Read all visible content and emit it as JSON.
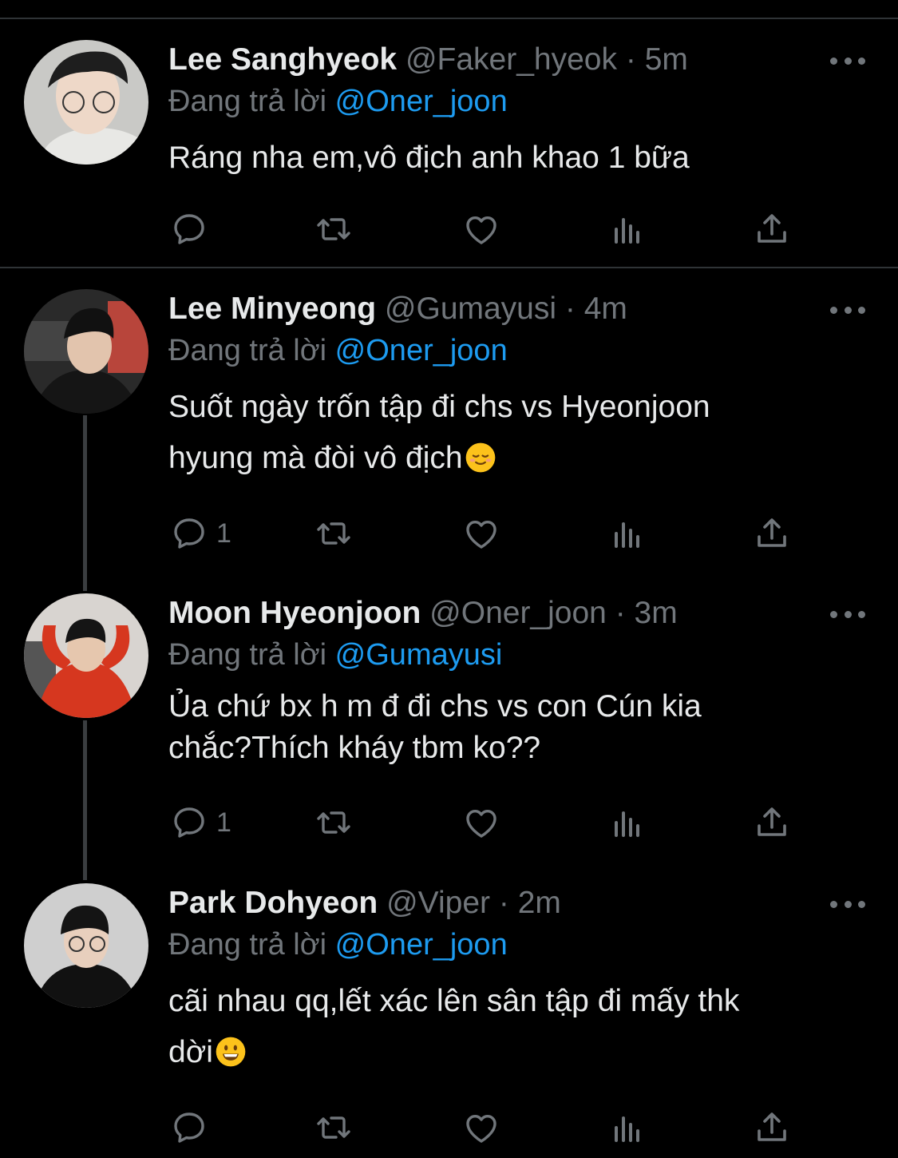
{
  "colors": {
    "background": "#000000",
    "text": "#e7e9ea",
    "muted": "#71767b",
    "accent": "#1d9bf0",
    "divider": "#2f3336"
  },
  "tweets": [
    {
      "name": "Lee Sanghyeok",
      "handle": "@Faker_hyeok",
      "separator": "·",
      "time": "5m",
      "reply_prefix": "Đang trả lời",
      "reply_to": "@Oner_joon",
      "text_lines": [
        "Ráng nha em,vô địch anh khao 1 bữa"
      ],
      "reply_count": "",
      "avatar_icon": "avatar-photo"
    },
    {
      "name": "Lee Minyeong",
      "handle": "@Gumayusi",
      "separator": "·",
      "time": "4m",
      "reply_prefix": "Đang trả lời",
      "reply_to": "@Oner_joon",
      "text_lines": [
        "Suốt ngày trốn tập đi chs vs Hyeonjoon",
        "hyung mà đòi vô địch"
      ],
      "text_emoji": "relieved-face-emoji",
      "reply_count": "1",
      "avatar_icon": "avatar-photo"
    },
    {
      "name": "Moon Hyeonjoon",
      "handle": "@Oner_joon",
      "separator": "·",
      "time": "3m",
      "reply_prefix": "Đang trả lời",
      "reply_to": "@Gumayusi",
      "text_lines": [
        "Ủa chứ bx h m đ đi chs vs con Cún kia",
        "chắc?Thích kháy tbm ko??"
      ],
      "reply_count": "1",
      "avatar_icon": "avatar-photo"
    },
    {
      "name": "Park Dohyeon",
      "handle": "@Viper",
      "separator": "·",
      "time": "2m",
      "reply_prefix": "Đang trả lời",
      "reply_to": "@Oner_joon",
      "text_lines": [
        "cãi nhau qq,lết xác lên sân tập đi mấy thk",
        "dời"
      ],
      "text_emoji": "smiling-face-emoji",
      "reply_count": "",
      "avatar_icon": "avatar-photo"
    }
  ],
  "action_icons": [
    "reply-icon",
    "retweet-icon",
    "like-icon",
    "analytics-icon",
    "share-icon"
  ]
}
